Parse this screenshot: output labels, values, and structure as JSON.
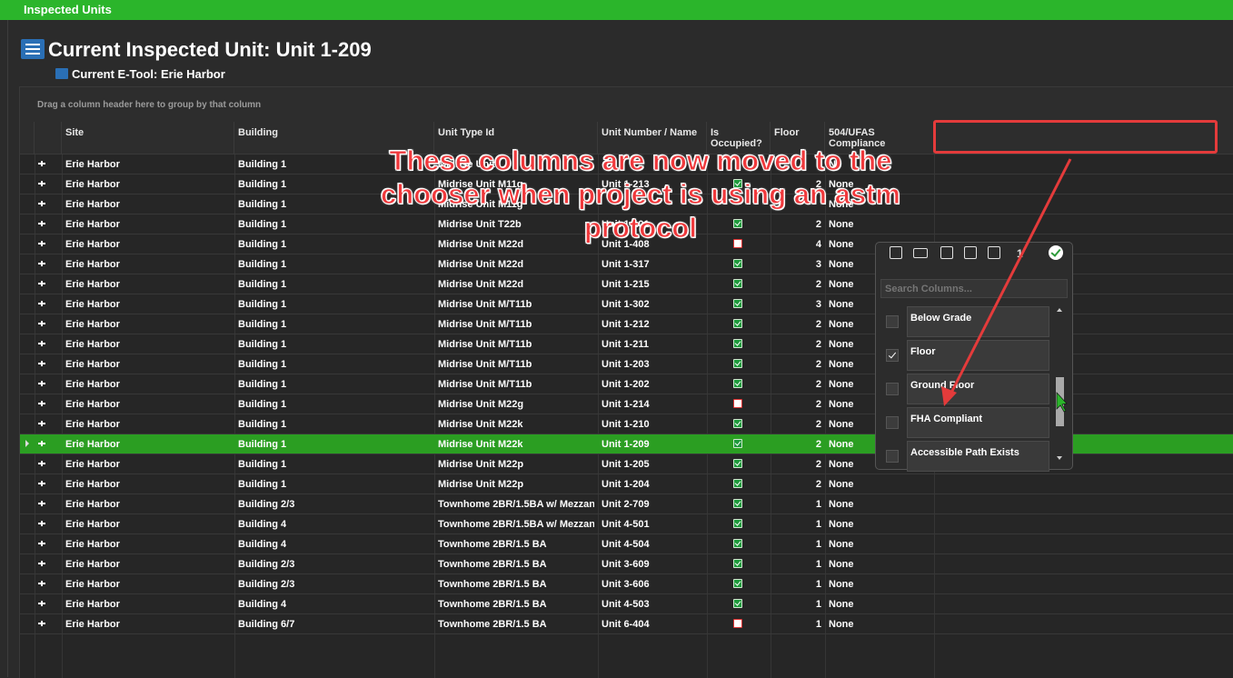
{
  "window": {
    "title": "Inspected Units"
  },
  "header": {
    "title": "Current Inspected Unit: Unit 1-209",
    "subtitle": "Current E-Tool: Erie Harbor"
  },
  "grid": {
    "group_hint": "Drag a column header here to group by that column",
    "columns": [
      "Site",
      "Building",
      "Unit Type Id",
      "Unit Number / Name",
      "Is Occupied?",
      "Floor",
      "504/UFAS Compliance"
    ],
    "rows": [
      {
        "site": "Erie Harbor",
        "building": "Building 1",
        "unit_type": "Midrise Unit",
        "unit": "",
        "occupied": "",
        "floor": "",
        "compliance": "N"
      },
      {
        "site": "Erie Harbor",
        "building": "Building 1",
        "unit_type": "Midrise Unit M11g",
        "unit": "Unit 1-213",
        "occupied": "yes",
        "floor": "2",
        "compliance": "None"
      },
      {
        "site": "Erie Harbor",
        "building": "Building 1",
        "unit_type": "Midrise Unit M11g",
        "unit": "",
        "occupied": "",
        "floor": "",
        "compliance": "None"
      },
      {
        "site": "Erie Harbor",
        "building": "Building 1",
        "unit_type": "Midrise Unit T22b",
        "unit": "Unit 1-101",
        "occupied": "yes",
        "floor": "2",
        "compliance": "None"
      },
      {
        "site": "Erie Harbor",
        "building": "Building 1",
        "unit_type": "Midrise Unit M22d",
        "unit": "Unit 1-408",
        "occupied": "no",
        "floor": "4",
        "compliance": "None"
      },
      {
        "site": "Erie Harbor",
        "building": "Building 1",
        "unit_type": "Midrise Unit M22d",
        "unit": "Unit 1-317",
        "occupied": "yes",
        "floor": "3",
        "compliance": "None"
      },
      {
        "site": "Erie Harbor",
        "building": "Building 1",
        "unit_type": "Midrise Unit M22d",
        "unit": "Unit 1-215",
        "occupied": "yes",
        "floor": "2",
        "compliance": "None"
      },
      {
        "site": "Erie Harbor",
        "building": "Building 1",
        "unit_type": "Midrise Unit M/T11b",
        "unit": "Unit 1-302",
        "occupied": "yes",
        "floor": "3",
        "compliance": "None"
      },
      {
        "site": "Erie Harbor",
        "building": "Building 1",
        "unit_type": "Midrise Unit M/T11b",
        "unit": "Unit 1-212",
        "occupied": "yes",
        "floor": "2",
        "compliance": "None"
      },
      {
        "site": "Erie Harbor",
        "building": "Building 1",
        "unit_type": "Midrise Unit M/T11b",
        "unit": "Unit 1-211",
        "occupied": "yes",
        "floor": "2",
        "compliance": "None"
      },
      {
        "site": "Erie Harbor",
        "building": "Building 1",
        "unit_type": "Midrise Unit M/T11b",
        "unit": "Unit 1-203",
        "occupied": "yes",
        "floor": "2",
        "compliance": "None"
      },
      {
        "site": "Erie Harbor",
        "building": "Building 1",
        "unit_type": "Midrise Unit M/T11b",
        "unit": "Unit 1-202",
        "occupied": "yes",
        "floor": "2",
        "compliance": "None"
      },
      {
        "site": "Erie Harbor",
        "building": "Building 1",
        "unit_type": "Midrise Unit M22g",
        "unit": "Unit 1-214",
        "occupied": "no",
        "floor": "2",
        "compliance": "None"
      },
      {
        "site": "Erie Harbor",
        "building": "Building 1",
        "unit_type": "Midrise Unit M22k",
        "unit": "Unit 1-210",
        "occupied": "yes",
        "floor": "2",
        "compliance": "None"
      },
      {
        "site": "Erie Harbor",
        "building": "Building 1",
        "unit_type": "Midrise Unit M22k",
        "unit": "Unit 1-209",
        "occupied": "yes",
        "floor": "2",
        "compliance": "None"
      },
      {
        "site": "Erie Harbor",
        "building": "Building 1",
        "unit_type": "Midrise Unit M22p",
        "unit": "Unit 1-205",
        "occupied": "yes",
        "floor": "2",
        "compliance": "None"
      },
      {
        "site": "Erie Harbor",
        "building": "Building 1",
        "unit_type": "Midrise Unit M22p",
        "unit": "Unit 1-204",
        "occupied": "yes",
        "floor": "2",
        "compliance": "None"
      },
      {
        "site": "Erie Harbor",
        "building": "Building 2/3",
        "unit_type": "Townhome 2BR/1.5BA w/ Mezzan...",
        "unit": "Unit 2-709",
        "occupied": "yes",
        "floor": "1",
        "compliance": "None"
      },
      {
        "site": "Erie Harbor",
        "building": "Building 4",
        "unit_type": "Townhome 2BR/1.5BA w/ Mezzan...",
        "unit": "Unit 4-501",
        "occupied": "yes",
        "floor": "1",
        "compliance": "None"
      },
      {
        "site": "Erie Harbor",
        "building": "Building 4",
        "unit_type": "Townhome 2BR/1.5 BA",
        "unit": "Unit 4-504",
        "occupied": "yes",
        "floor": "1",
        "compliance": "None"
      },
      {
        "site": "Erie Harbor",
        "building": "Building 2/3",
        "unit_type": "Townhome 2BR/1.5 BA",
        "unit": "Unit 3-609",
        "occupied": "yes",
        "floor": "1",
        "compliance": "None"
      },
      {
        "site": "Erie Harbor",
        "building": "Building 2/3",
        "unit_type": "Townhome 2BR/1.5 BA",
        "unit": "Unit 3-606",
        "occupied": "yes",
        "floor": "1",
        "compliance": "None"
      },
      {
        "site": "Erie Harbor",
        "building": "Building 4",
        "unit_type": "Townhome 2BR/1.5 BA",
        "unit": "Unit 4-503",
        "occupied": "yes",
        "floor": "1",
        "compliance": "None"
      },
      {
        "site": "Erie Harbor",
        "building": "Building 6/7",
        "unit_type": "Townhome 2BR/1.5 BA",
        "unit": "Unit 6-404",
        "occupied": "no",
        "floor": "1",
        "compliance": "None"
      }
    ],
    "selected_unit": "Unit 1-209"
  },
  "chooser": {
    "toolbar_counter": "1",
    "search_placeholder": "Search Columns...",
    "items": [
      {
        "label": "Below Grade",
        "checked": false
      },
      {
        "label": "Floor",
        "checked": true
      },
      {
        "label": "Ground Floor",
        "checked": false
      },
      {
        "label": "FHA Compliant",
        "checked": false
      },
      {
        "label": "Accessible Path Exists",
        "checked": false
      }
    ]
  },
  "annotation": {
    "text_lines": [
      "These columns are now moved to the",
      "chooser when project is using an astm",
      "protocol"
    ]
  },
  "colors": {
    "accent_green": "#2bb52b",
    "selected_row": "#2b9e22",
    "annotation_red": "#e43b3b"
  }
}
